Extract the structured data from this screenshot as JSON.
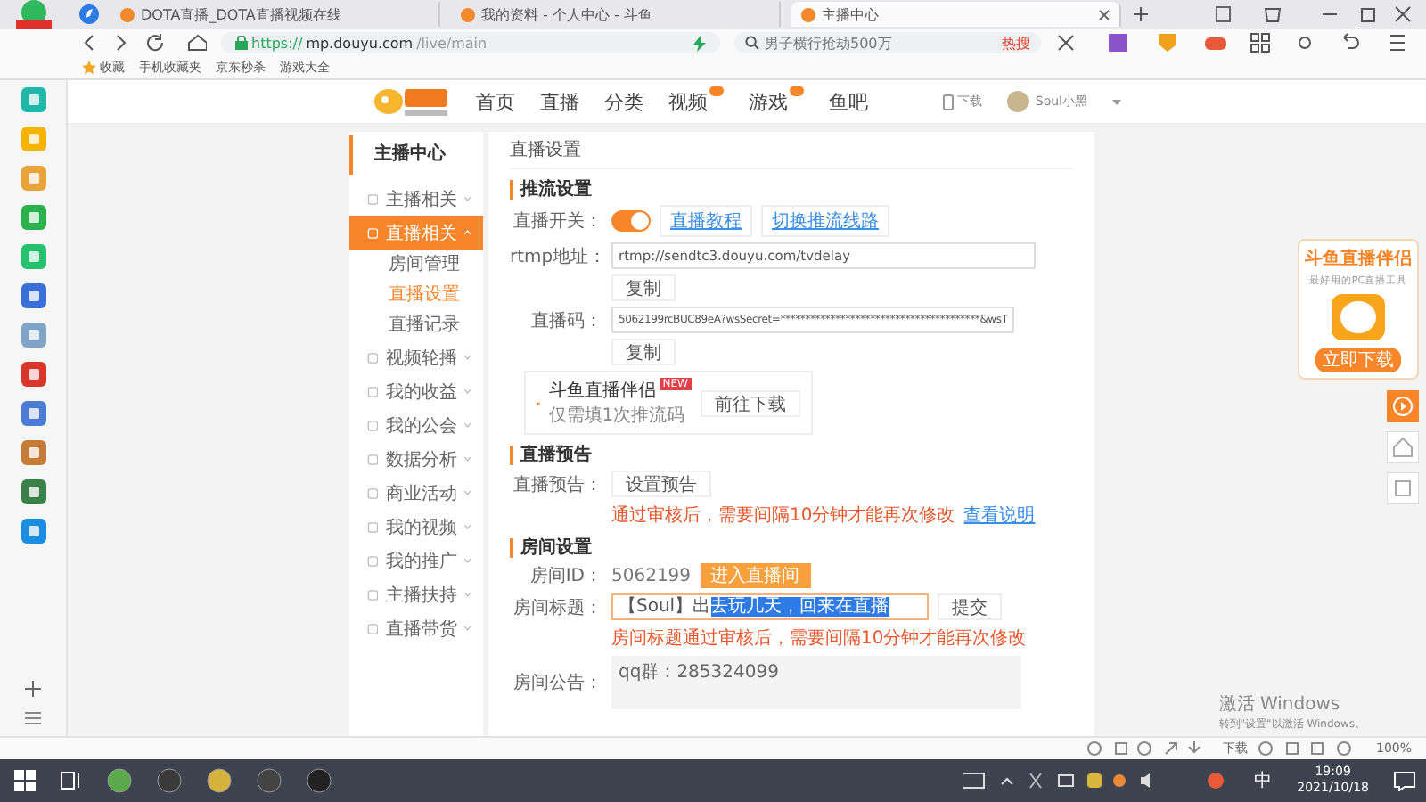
{
  "browser": {
    "tabs": [
      {
        "title": "DOTA直播_DOTA直播视频在线",
        "selected": false
      },
      {
        "title": "我的资料 - 个人中心 - 斗鱼",
        "selected": false
      },
      {
        "title": "主播中心",
        "selected": true
      }
    ],
    "url_scheme": "https://",
    "url_host": "mp.douyu.com",
    "url_path": "/live/main",
    "search_placeholder": "男子横行抢劫500万",
    "search_hot": "热搜",
    "bookmarks": [
      "收藏",
      "手机收藏夹",
      "京东秒杀",
      "游戏大全"
    ]
  },
  "site_nav": {
    "items": [
      {
        "label": "首页",
        "badge": false
      },
      {
        "label": "直播",
        "badge": false
      },
      {
        "label": "分类",
        "badge": false
      },
      {
        "label": "视频",
        "badge": true
      },
      {
        "label": "游戏",
        "badge": true
      },
      {
        "label": "鱼吧",
        "badge": false
      }
    ],
    "download": "下载",
    "user": "Soul小黑"
  },
  "sidebar": {
    "title": "主播中心",
    "items": [
      {
        "label": "主播相关",
        "selected": false,
        "expanded": false
      },
      {
        "label": "直播相关",
        "selected": true,
        "expanded": true,
        "children": [
          {
            "label": "房间管理",
            "selected": false
          },
          {
            "label": "直播设置",
            "selected": true
          },
          {
            "label": "直播记录",
            "selected": false
          }
        ]
      },
      {
        "label": "视频轮播",
        "selected": false,
        "expanded": false
      },
      {
        "label": "我的收益",
        "selected": false,
        "expanded": false
      },
      {
        "label": "我的公会",
        "selected": false,
        "expanded": false
      },
      {
        "label": "数据分析",
        "selected": false,
        "expanded": false
      },
      {
        "label": "商业活动",
        "selected": false,
        "expanded": false
      },
      {
        "label": "我的视频",
        "selected": false,
        "expanded": false
      },
      {
        "label": "我的推广",
        "selected": false,
        "expanded": false
      },
      {
        "label": "主播扶持",
        "selected": false,
        "expanded": false
      },
      {
        "label": "直播带货",
        "selected": false,
        "expanded": false
      }
    ]
  },
  "main": {
    "title": "直播设置",
    "push": {
      "heading": "推流设置",
      "switch_label": "直播开关：",
      "live_on": true,
      "links": [
        "直播教程",
        "切换推流线路"
      ],
      "rtmp_label": "rtmp地址：",
      "rtmp_value": "rtmp://sendtc3.douyu.com/tvdelay",
      "copy": "复制",
      "code_label": "直播码：",
      "code_value": "5062199rcBUC89eA?wsSecret=****************************************&wsT",
      "copy2": "复制",
      "promo_title": "斗鱼直播伴侣",
      "promo_badge": "NEW",
      "promo_sub": "仅需填1次推流码",
      "promo_button": "前往下载"
    },
    "preview": {
      "heading": "直播预告",
      "label": "直播预告：",
      "button": "设置预告",
      "warning": "通过审核后，需要间隔10分钟才能再次修改",
      "link": "查看说明"
    },
    "room": {
      "heading": "房间设置",
      "id_label": "房间ID：",
      "id_value": "5062199",
      "enter_button": "进入直播间",
      "title_label": "房间标题：",
      "title_value": "【Soul】出",
      "title_selected": "去玩几天，回来在直播",
      "submit": "提交",
      "title_warning": "房间标题通过审核后，需要间隔10分钟才能再次修改",
      "notice_label": "房间公告：",
      "notice_value": "qq群：285324099"
    }
  },
  "promo_float": {
    "title": "斗鱼直播伴侣",
    "sub": "最好用的PC直播工具",
    "button": "立即下载"
  },
  "activation": {
    "title": "激活 Windows",
    "sub": "转到\"设置\"以激活 Windows。"
  },
  "status_bar": {
    "download": "下载",
    "zoom": "100%"
  },
  "taskbar": {
    "ime": "中",
    "time": "19:09",
    "date": "2021/10/18"
  }
}
